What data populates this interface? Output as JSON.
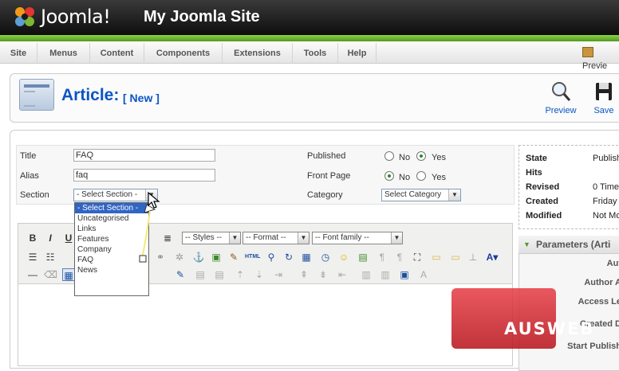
{
  "header": {
    "brand": "Joomla!",
    "site_name": "My Joomla Site"
  },
  "menu": [
    {
      "label": "Site"
    },
    {
      "label": "Menus"
    },
    {
      "label": "Content"
    },
    {
      "label": "Components"
    },
    {
      "label": "Extensions"
    },
    {
      "label": "Tools"
    },
    {
      "label": "Help"
    }
  ],
  "top_preview": "Previe",
  "toolbar": {
    "title": "Article:",
    "subtitle": "[ New ]",
    "preview": "Preview",
    "save": "Save"
  },
  "form": {
    "title_label": "Title",
    "title_value": "FAQ",
    "alias_label": "Alias",
    "alias_value": "faq",
    "section_label": "Section",
    "section_value": "- Select Section -",
    "published_label": "Published",
    "frontpage_label": "Front Page",
    "no": "No",
    "yes": "Yes",
    "category_label": "Category",
    "category_value": "Select Category"
  },
  "section_options": [
    {
      "label": "- Select Section -",
      "selected": true
    },
    {
      "label": "Uncategorised"
    },
    {
      "label": "Links"
    },
    {
      "label": "Features"
    },
    {
      "label": "Company"
    },
    {
      "label": "FAQ"
    },
    {
      "label": "News"
    }
  ],
  "editor": {
    "styles": "-- Styles --",
    "format": "-- Format --",
    "fontfamily": "-- Font family --",
    "bold": "B",
    "italic": "I",
    "underline": "U"
  },
  "info": {
    "state_label": "State",
    "state_value": "Publish",
    "hits_label": "Hits",
    "revised_label": "Revised",
    "revised_value": "0 Time",
    "created_label": "Created",
    "created_value": "Friday",
    "modified_label": "Modified",
    "modified_value": "Not Mo"
  },
  "params": {
    "title": "Parameters (Arti",
    "rows": [
      {
        "label": "Aut"
      },
      {
        "label": "Author A"
      },
      {
        "label": "Access Le"
      },
      {
        "label": "Created D"
      },
      {
        "label": "Start Publish"
      }
    ]
  },
  "watermark": "AUSWEB",
  "colors": {
    "accent": "#0b55c4",
    "green": "#4f9a1c",
    "watermark": "#c8242c"
  }
}
